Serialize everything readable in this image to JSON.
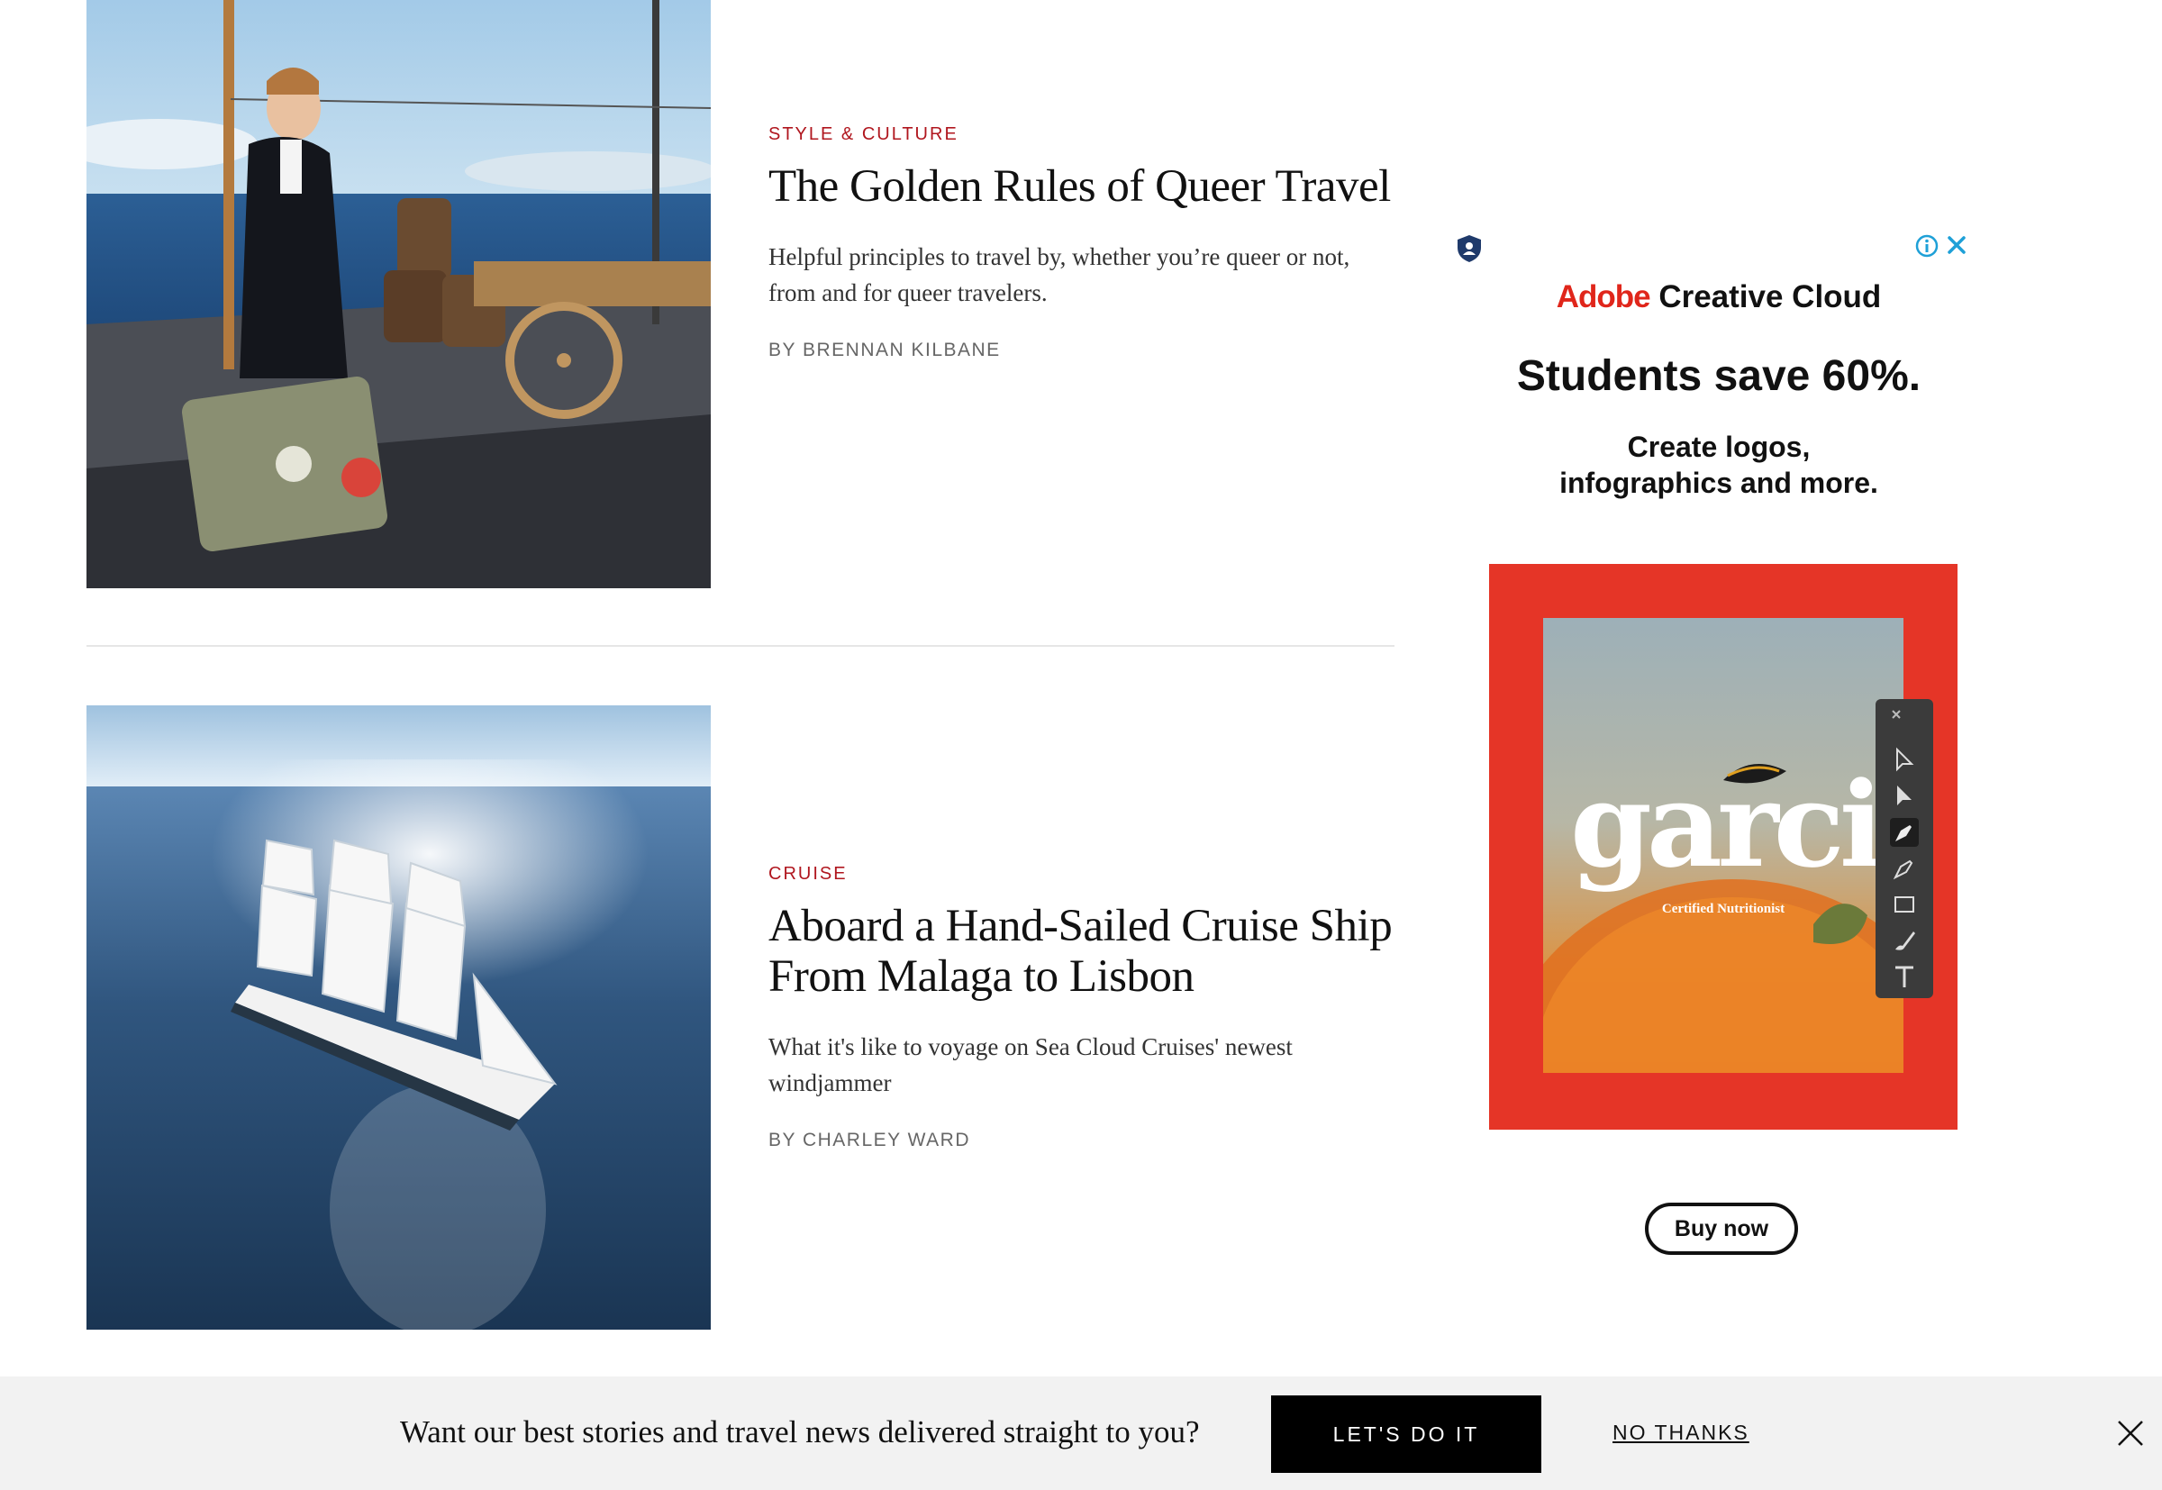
{
  "articles": [
    {
      "kicker": "STYLE & CULTURE",
      "headline": "The Golden Rules of Queer Travel",
      "dek": "Helpful principles to travel by, whether you’re queer or not, from and for queer travelers.",
      "byline": "BY BRENNAN KILBANE"
    },
    {
      "kicker": "CRUISE",
      "headline": "Aboard a Hand-Sailed Cruise Ship From Malaga to Lisbon",
      "dek": "What it's like to voyage on Sea Cloud Cruises' newest windjammer",
      "byline": "BY CHARLEY WARD"
    }
  ],
  "ad": {
    "brand_red": "Adobe",
    "brand_dark": "Creative Cloud",
    "headline": "Students save 60%.",
    "sub_line1": "Create logos,",
    "sub_line2": "infographics and more.",
    "art_wordmark": "garcia",
    "art_caption": "Certified Nutritionist",
    "cta": "Buy now",
    "colors": {
      "brand": "#e0261b",
      "art_frame": "#e53527"
    },
    "icons": [
      "shield-icon",
      "info-icon",
      "close-icon"
    ]
  },
  "newsletter": {
    "prompt": "Want our best stories and travel news delivered straight to you?",
    "accept": "LET'S DO IT",
    "decline": "NO THANKS"
  },
  "theme": {
    "kicker_color": "#b0161e",
    "text": "#111111",
    "muted": "#666666"
  }
}
